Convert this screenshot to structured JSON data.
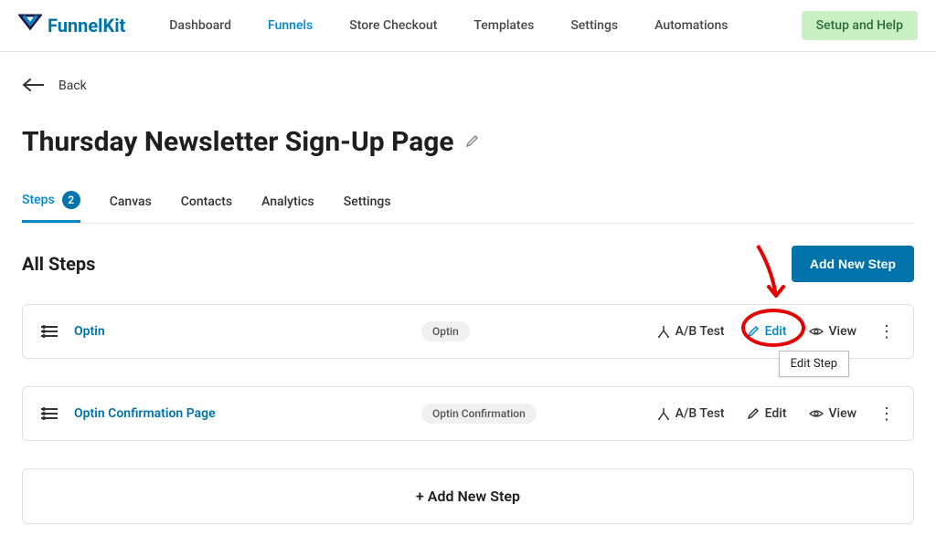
{
  "brand": "FunnelKit",
  "topnav": {
    "dashboard": "Dashboard",
    "funnels": "Funnels",
    "store_checkout": "Store Checkout",
    "templates": "Templates",
    "settings": "Settings",
    "automations": "Automations"
  },
  "help_button": "Setup and Help",
  "back": "Back",
  "page_title": "Thursday Newsletter Sign-Up Page",
  "tabs": {
    "steps": "Steps",
    "steps_count": "2",
    "canvas": "Canvas",
    "contacts": "Contacts",
    "analytics": "Analytics",
    "settings": "Settings"
  },
  "section_title": "All Steps",
  "add_new_step_button": "Add New Step",
  "steps": [
    {
      "name": "Optin",
      "type": "Optin"
    },
    {
      "name": "Optin Confirmation Page",
      "type": "Optin Confirmation"
    }
  ],
  "actions": {
    "ab_test": "A/B Test",
    "edit": "Edit",
    "view": "View"
  },
  "tooltip": "Edit Step",
  "add_step_row": "+  Add New Step"
}
